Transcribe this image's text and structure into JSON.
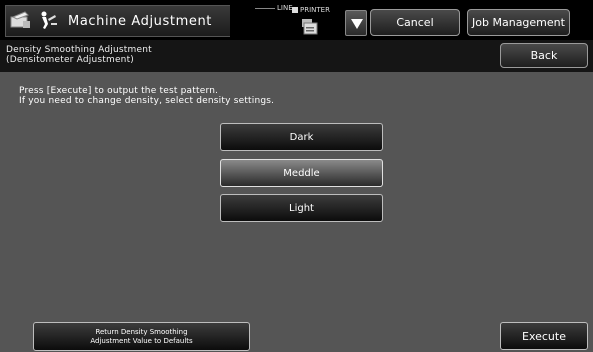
{
  "header": {
    "title": "Machine Adjustment",
    "line_label": "LINE",
    "printer_label": "PRINTER",
    "cancel_label": "Cancel",
    "job_management_label": "Job Management"
  },
  "subheader": {
    "line1": "Density Smoothing Adjustment",
    "line2": "(Densitometer Adjustment)",
    "back_label": "Back"
  },
  "main": {
    "instruction1": "Press [Execute] to output the test pattern.",
    "instruction2": "If you need to change density, select density settings.",
    "density_options": [
      "Dark",
      "Meddle",
      "Light"
    ],
    "selected_option": "Meddle"
  },
  "footer": {
    "return_line1": "Return Density Smoothing",
    "return_line2": "Adjustment Value to Defaults",
    "execute_label": "Execute"
  },
  "icons": {
    "scanner": "copier-icon",
    "adjust": "adjustment-icon",
    "printer": "printer-icon",
    "dropdown": "dropdown-arrow-icon"
  }
}
